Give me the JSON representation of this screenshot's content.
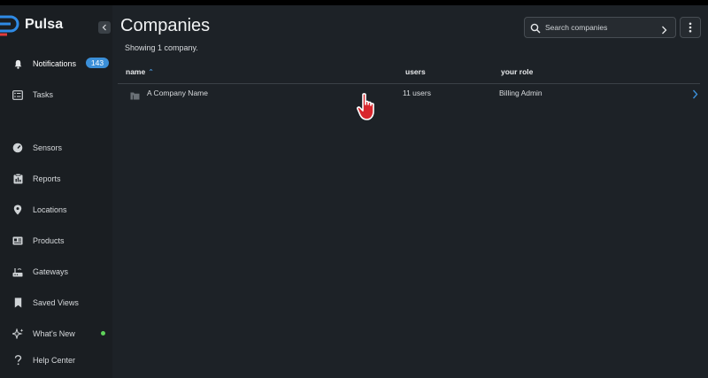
{
  "app": {
    "name": "Pulsa"
  },
  "sidebar": {
    "items": [
      {
        "label": "Notifications",
        "icon": "bell-icon",
        "badge": "143",
        "active": true
      },
      {
        "label": "Tasks",
        "icon": "checklist-icon"
      },
      {
        "label": "Sensors",
        "icon": "gauge-icon"
      },
      {
        "label": "Reports",
        "icon": "clipboard-icon"
      },
      {
        "label": "Locations",
        "icon": "location-pin-icon"
      },
      {
        "label": "Products",
        "icon": "product-card-icon"
      },
      {
        "label": "Gateways",
        "icon": "router-icon"
      },
      {
        "label": "Saved Views",
        "icon": "bookmark-icon"
      },
      {
        "label": "What's New",
        "icon": "sparkle-icon",
        "indicator_color": "#5fd35a"
      },
      {
        "label": "Help Center",
        "icon": "question-icon"
      }
    ]
  },
  "page": {
    "title": "Companies",
    "subtitle": "Showing 1 company."
  },
  "search": {
    "placeholder": "Search companies"
  },
  "table": {
    "columns": [
      "name",
      "users",
      "your role"
    ],
    "sorted_column": "name",
    "rows": [
      {
        "name": "A Company Name",
        "users": "11 users",
        "role": "Billing Admin"
      }
    ]
  },
  "colors": {
    "accent": "#3b8fd8",
    "background": "#1d2227",
    "sidebar": "#1a1e22",
    "logo_blue": "#2f8be6",
    "logo_red": "#e03c3c"
  }
}
